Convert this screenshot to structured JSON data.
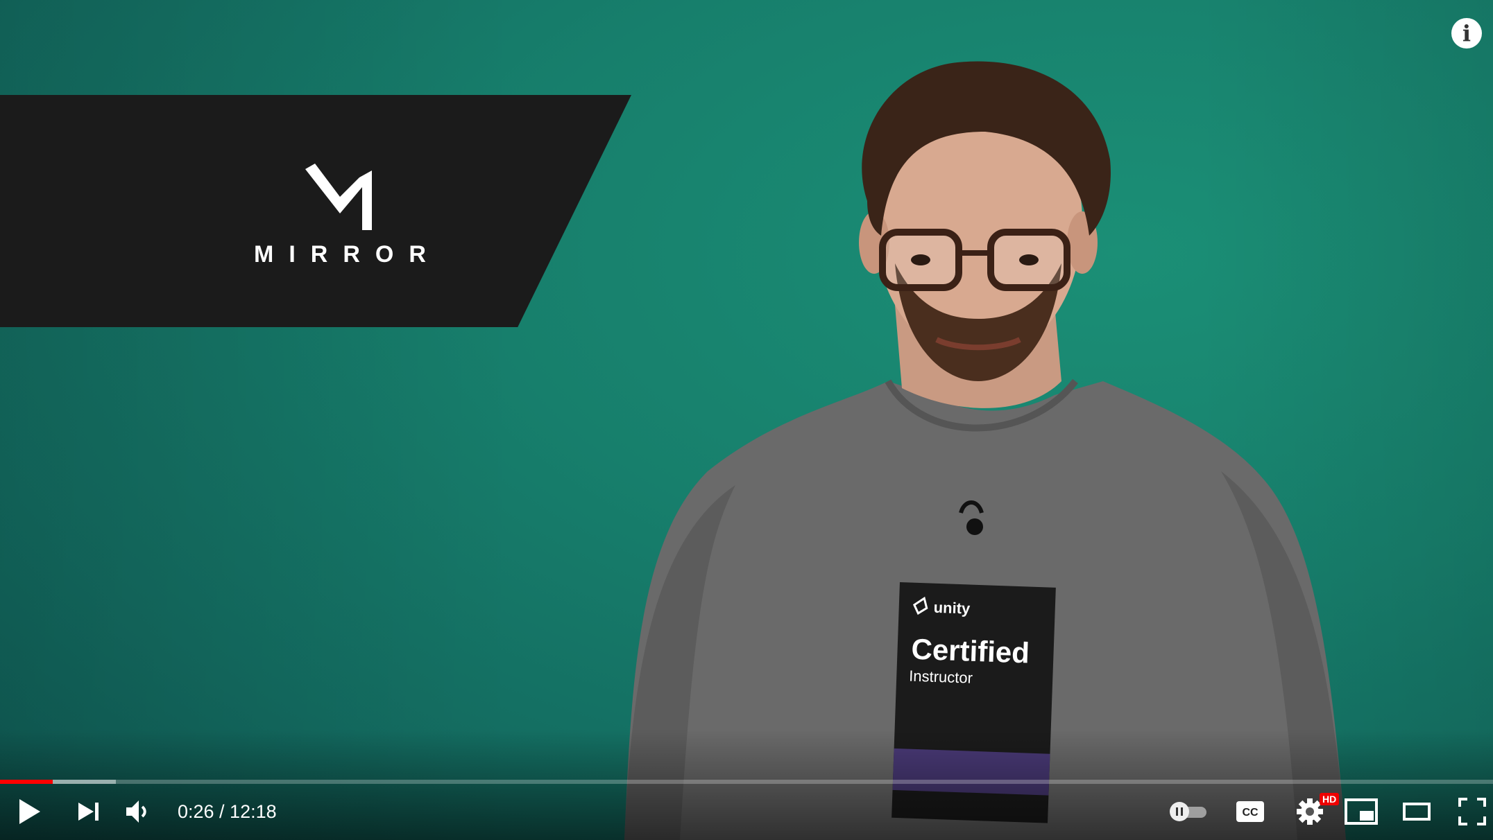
{
  "banner": {
    "logo_text": "MIRROR"
  },
  "shirt": {
    "brand": "unity",
    "title": "Certified",
    "subtitle": "Instructor"
  },
  "player": {
    "current_time": "0:26",
    "duration": "12:18",
    "time_display": "0:26 / 12:18",
    "progress": {
      "played_fraction": 0.0353,
      "buffered_fraction": 0.0775
    },
    "info_glyph": "i",
    "hd_badge": "HD",
    "icons": [
      "play-icon",
      "next-icon",
      "volume-icon",
      "autoplay-toggle-icon",
      "cc-icon",
      "settings-icon",
      "miniplayer-icon",
      "theater-icon",
      "fullscreen-icon",
      "info-icon"
    ]
  },
  "colors": {
    "accent": "#ff0000",
    "background": "#177f6c"
  }
}
